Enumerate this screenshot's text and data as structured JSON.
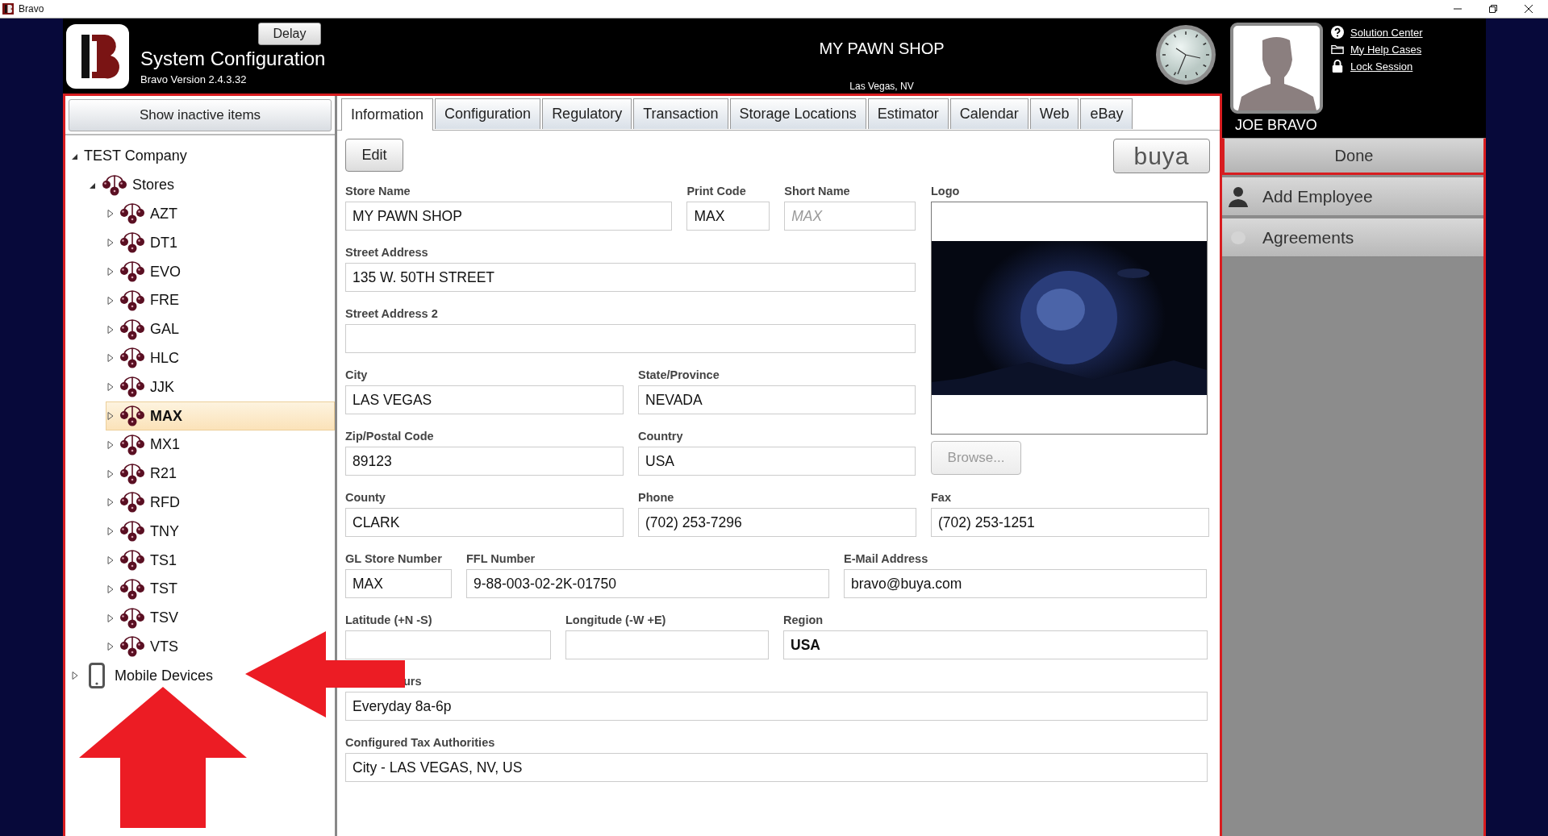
{
  "window": {
    "title": "Bravo"
  },
  "header": {
    "delay_button": "Delay",
    "title": "System Configuration",
    "version": "Bravo Version 2.4.3.32",
    "store_name": "MY PAWN SHOP",
    "store_location": "Las Vegas, NV"
  },
  "user": {
    "links": [
      {
        "label": "Solution Center",
        "kind": "help"
      },
      {
        "label": "My Help Cases",
        "kind": "folder"
      },
      {
        "label": "Lock Session",
        "kind": "lock"
      }
    ],
    "name": "JOE BRAVO"
  },
  "done_button": "Done",
  "actions": [
    {
      "label": "Add Employee",
      "kind": "person"
    },
    {
      "label": "Agreements",
      "kind": "dot"
    }
  ],
  "sidebar": {
    "button": "Show inactive items",
    "tree": [
      {
        "label": "TEST Company",
        "kind": "company",
        "expanded": true,
        "selected": false,
        "children": [
          {
            "label": "Stores",
            "kind": "stores",
            "expanded": true,
            "selected": false,
            "children": [
              {
                "label": "AZT",
                "kind": "store",
                "expanded": false,
                "selected": false
              },
              {
                "label": "DT1",
                "kind": "store",
                "expanded": false,
                "selected": false
              },
              {
                "label": "EVO",
                "kind": "store",
                "expanded": false,
                "selected": false
              },
              {
                "label": "FRE",
                "kind": "store",
                "expanded": false,
                "selected": false
              },
              {
                "label": "GAL",
                "kind": "store",
                "expanded": false,
                "selected": false
              },
              {
                "label": "HLC",
                "kind": "store",
                "expanded": false,
                "selected": false
              },
              {
                "label": "JJK",
                "kind": "store",
                "expanded": false,
                "selected": false
              },
              {
                "label": "MAX",
                "kind": "store",
                "expanded": false,
                "selected": true
              },
              {
                "label": "MX1",
                "kind": "store",
                "expanded": false,
                "selected": false
              },
              {
                "label": "R21",
                "kind": "store",
                "expanded": false,
                "selected": false
              },
              {
                "label": "RFD",
                "kind": "store",
                "expanded": false,
                "selected": false
              },
              {
                "label": "TNY",
                "kind": "store",
                "expanded": false,
                "selected": false
              },
              {
                "label": "TS1",
                "kind": "store",
                "expanded": false,
                "selected": false
              },
              {
                "label": "TST",
                "kind": "store",
                "expanded": false,
                "selected": false
              },
              {
                "label": "TSV",
                "kind": "store",
                "expanded": false,
                "selected": false
              },
              {
                "label": "VTS",
                "kind": "store",
                "expanded": false,
                "selected": false
              }
            ]
          }
        ]
      },
      {
        "label": "Mobile Devices",
        "kind": "devices",
        "expanded": false,
        "selected": false
      }
    ]
  },
  "tabs": [
    {
      "label": "Information",
      "selected": true
    },
    {
      "label": "Configuration",
      "selected": false
    },
    {
      "label": "Regulatory",
      "selected": false
    },
    {
      "label": "Transaction",
      "selected": false
    },
    {
      "label": "Storage Locations",
      "selected": false
    },
    {
      "label": "Estimator",
      "selected": false
    },
    {
      "label": "Calendar",
      "selected": false
    },
    {
      "label": "Web",
      "selected": false
    },
    {
      "label": "eBay",
      "selected": false
    }
  ],
  "toolbar": {
    "edit_button": "Edit",
    "brand_button": "buya"
  },
  "form": {
    "rows": [
      [
        {
          "label": "Store Name",
          "value": "MY PAWN SHOP"
        },
        {
          "label": "Print Code",
          "value": "MAX"
        },
        {
          "label": "Short Name",
          "placeholder": "MAX"
        }
      ],
      [
        {
          "label": "Street Address",
          "value": "135 W. 50TH STREET"
        }
      ],
      [
        {
          "label": "Street Address 2"
        }
      ],
      [
        {
          "label": "City",
          "value": "LAS VEGAS"
        },
        {
          "label": "State/Province",
          "value": "NEVADA"
        }
      ],
      [
        {
          "label": "Zip/Postal Code",
          "value": "89123"
        },
        {
          "label": "Country",
          "value": "USA"
        }
      ],
      [
        {
          "label": "County",
          "value": "CLARK"
        },
        {
          "label": "Phone",
          "value": "(702) 253-7296"
        },
        {
          "label": "Fax",
          "value": "(702) 253-1251"
        }
      ],
      [
        {
          "label": "GL Store Number",
          "value": "MAX"
        },
        {
          "label": "FFL Number",
          "value": "9-88-003-02-2K-01750"
        },
        {
          "label": "E-Mail Address",
          "value": "bravo@buya.com"
        }
      ],
      [
        {
          "label": "Latitude (+N -S)"
        },
        {
          "label": "Longitude (-W +E)"
        },
        {
          "label": "Region",
          "value": "USA",
          "bold": true
        }
      ],
      [
        {
          "label": "urs",
          "value": "Everyday 8a-6p"
        }
      ],
      [
        {
          "label": "Configured Tax Authorities",
          "value": "City - LAS VEGAS, NV, US"
        }
      ]
    ],
    "logo": {
      "label": "Logo",
      "browse_button": "Browse...",
      "browse_disabled": true
    }
  },
  "annotations": [
    {
      "kind": "arrow-left"
    },
    {
      "kind": "arrow-up"
    }
  ]
}
